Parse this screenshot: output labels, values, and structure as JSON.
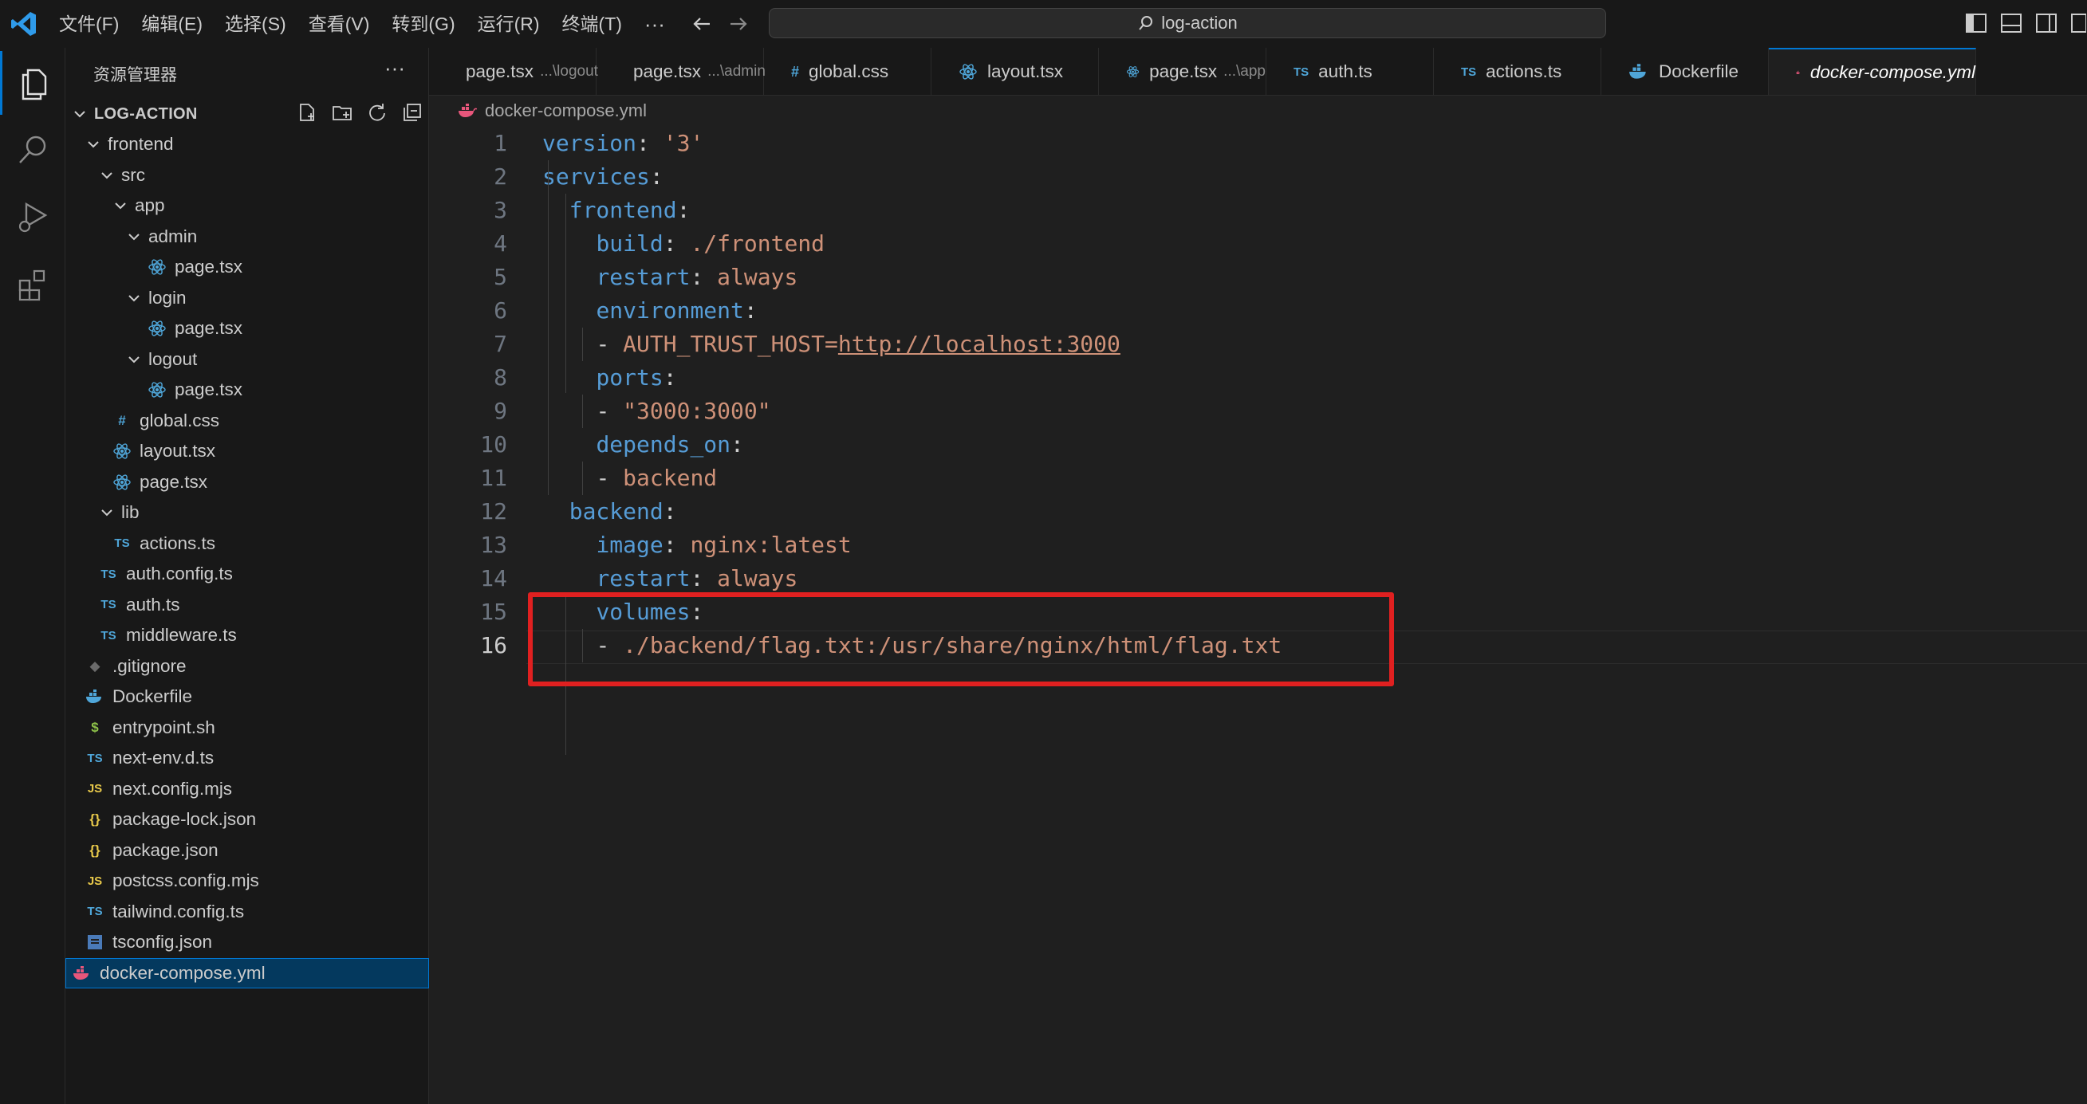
{
  "window": {
    "menu": [
      "文件(F)",
      "编辑(E)",
      "选择(S)",
      "查看(V)",
      "转到(G)",
      "运行(R)",
      "终端(T)"
    ],
    "more": "···",
    "search_text": "log-action"
  },
  "sidebar": {
    "title": "资源管理器",
    "more": "···",
    "root": "LOG-ACTION",
    "items": [
      {
        "label": "frontend",
        "type": "folder"
      },
      {
        "label": "src",
        "type": "folder"
      },
      {
        "label": "app",
        "type": "folder"
      },
      {
        "label": "admin",
        "type": "folder"
      },
      {
        "label": "page.tsx",
        "type": "react"
      },
      {
        "label": "login",
        "type": "folder"
      },
      {
        "label": "page.tsx",
        "type": "react"
      },
      {
        "label": "logout",
        "type": "folder"
      },
      {
        "label": "page.tsx",
        "type": "react"
      },
      {
        "label": "global.css",
        "type": "css"
      },
      {
        "label": "layout.tsx",
        "type": "react"
      },
      {
        "label": "page.tsx",
        "type": "react"
      },
      {
        "label": "lib",
        "type": "folder"
      },
      {
        "label": "actions.ts",
        "type": "ts"
      },
      {
        "label": "auth.config.ts",
        "type": "ts"
      },
      {
        "label": "auth.ts",
        "type": "ts"
      },
      {
        "label": "middleware.ts",
        "type": "ts"
      },
      {
        "label": ".gitignore",
        "type": "git"
      },
      {
        "label": "Dockerfile",
        "type": "docker"
      },
      {
        "label": "entrypoint.sh",
        "type": "shell"
      },
      {
        "label": "next-env.d.ts",
        "type": "ts"
      },
      {
        "label": "next.config.mjs",
        "type": "js"
      },
      {
        "label": "package-lock.json",
        "type": "json"
      },
      {
        "label": "package.json",
        "type": "json"
      },
      {
        "label": "postcss.config.mjs",
        "type": "js"
      },
      {
        "label": "tailwind.config.ts",
        "type": "ts"
      },
      {
        "label": "tsconfig.json",
        "type": "tsconfig"
      },
      {
        "label": "docker-compose.yml",
        "type": "compose"
      }
    ]
  },
  "tabs": [
    {
      "label": "page.tsx",
      "desc": "...\\logout",
      "type": "react"
    },
    {
      "label": "page.tsx",
      "desc": "...\\admin",
      "type": "react"
    },
    {
      "label": "global.css",
      "desc": "",
      "type": "css"
    },
    {
      "label": "layout.tsx",
      "desc": "",
      "type": "react"
    },
    {
      "label": "page.tsx",
      "desc": "...\\app",
      "type": "react"
    },
    {
      "label": "auth.ts",
      "desc": "",
      "type": "ts"
    },
    {
      "label": "actions.ts",
      "desc": "",
      "type": "ts"
    },
    {
      "label": "Dockerfile",
      "desc": "",
      "type": "docker"
    },
    {
      "label": "docker-compose.yml",
      "desc": "",
      "type": "compose"
    }
  ],
  "breadcrumb": "docker-compose.yml",
  "editor": {
    "current_line": 16,
    "lines": [
      {
        "n": "1",
        "key": "version",
        "value": "'3'"
      },
      {
        "n": "2",
        "key": "services",
        "value": ""
      },
      {
        "n": "3",
        "key": "frontend",
        "value": ""
      },
      {
        "n": "4",
        "key": "build",
        "value": "./frontend"
      },
      {
        "n": "5",
        "key": "restart",
        "value": "always"
      },
      {
        "n": "6",
        "key": "environment",
        "value": ""
      },
      {
        "n": "7",
        "item": "AUTH_TRUST_HOST=",
        "url": "http://localhost:3000"
      },
      {
        "n": "8",
        "key": "ports",
        "value": ""
      },
      {
        "n": "9",
        "item": "\"3000:3000\""
      },
      {
        "n": "10",
        "key": "depends_on",
        "value": ""
      },
      {
        "n": "11",
        "item": "backend"
      },
      {
        "n": "12",
        "key": "backend",
        "value": ""
      },
      {
        "n": "13",
        "key": "image",
        "value": "nginx:latest"
      },
      {
        "n": "14",
        "key": "restart",
        "value": "always"
      },
      {
        "n": "15",
        "key": "volumes",
        "value": ""
      },
      {
        "n": "16",
        "item": "./backend/flag.txt:/usr/share/nginx/html/flag.txt"
      }
    ]
  },
  "colors": {
    "keyword": "#569cd6",
    "string": "#ce9178",
    "accent": "#0078d4",
    "annotation": "#e02020"
  }
}
